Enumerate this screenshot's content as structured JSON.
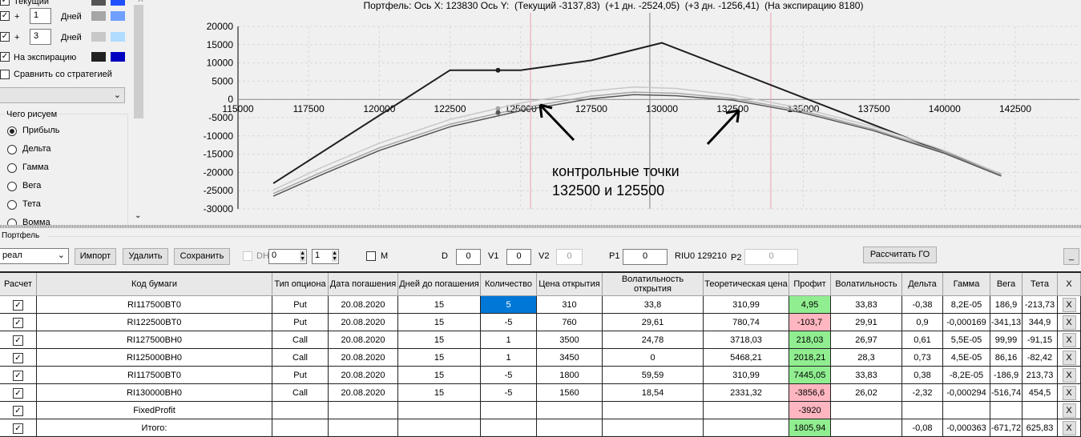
{
  "left_panel": {
    "rows": [
      {
        "label": "Текущий",
        "checked": true,
        "colors": [
          "#555555",
          "#2050ff"
        ]
      },
      {
        "prefix": "+",
        "days": "1",
        "label": "Дней",
        "checked": true,
        "colors": [
          "#a6a6a6",
          "#70a0ff"
        ]
      },
      {
        "prefix": "+",
        "days": "3",
        "label": "Дней",
        "checked": true,
        "colors": [
          "#c8c8c8",
          "#b0dcff"
        ]
      },
      {
        "label": "На экспирацию",
        "checked": true,
        "colors": [
          "#202020",
          "#0000c0"
        ]
      }
    ],
    "compare_label": "Сравнить со стратегией",
    "compare_select": "",
    "group_title": "Чего рисуем",
    "radios": [
      "Прибыль",
      "Дельта",
      "Гамма",
      "Вега",
      "Тета",
      "Вомма"
    ],
    "selected_radio": "Прибыль",
    "close_label": "X"
  },
  "chart_data": {
    "type": "line",
    "title": "Портфель: Ось X: 123830 Ось Y:  (Текущий -3137,83)  (+1 дн. -2524,05)  (+3 дн. -1256,41)  (На экспирацию 8180)",
    "xlim": [
      115000,
      142500
    ],
    "ylim": [
      -30000,
      20000
    ],
    "x_ticks": [
      115000,
      117500,
      120000,
      122500,
      125000,
      127500,
      130000,
      132500,
      135000,
      137500,
      140000,
      142500
    ],
    "y_ticks": [
      20000,
      15000,
      10000,
      5000,
      0,
      -5000,
      -10000,
      -15000,
      -20000,
      -25000,
      -30000
    ],
    "grid": true,
    "vertical_markers": [
      {
        "x": 125350,
        "color": "#f0a0b0"
      },
      {
        "x": 133850,
        "color": "#f0a0b0"
      },
      {
        "x": 129570,
        "color": "#808080"
      }
    ],
    "series": [
      {
        "key": "expiration",
        "color": "#202020",
        "points": [
          [
            116250,
            -23000
          ],
          [
            122500,
            8000
          ],
          [
            125000,
            8000
          ],
          [
            127500,
            10700
          ],
          [
            130000,
            15500
          ],
          [
            142000,
            -20500
          ]
        ],
        "marker": [
          124200,
          8000
        ]
      },
      {
        "key": "plus3",
        "color": "#c8c8c8",
        "points": [
          [
            116250,
            -24800
          ],
          [
            118000,
            -18500
          ],
          [
            120000,
            -12000
          ],
          [
            122500,
            -5500
          ],
          [
            125000,
            -1000
          ],
          [
            127500,
            2300
          ],
          [
            129000,
            3400
          ],
          [
            130500,
            3000
          ],
          [
            132500,
            1200
          ],
          [
            135000,
            -2500
          ],
          [
            137500,
            -7500
          ],
          [
            140000,
            -14000
          ],
          [
            142000,
            -20500
          ]
        ]
      },
      {
        "key": "plus1",
        "color": "#a6a6a6",
        "points": [
          [
            116250,
            -25800
          ],
          [
            118000,
            -19800
          ],
          [
            120000,
            -13300
          ],
          [
            122500,
            -6800
          ],
          [
            125000,
            -2400
          ],
          [
            127500,
            900
          ],
          [
            129000,
            2000
          ],
          [
            130500,
            1700
          ],
          [
            132500,
            300
          ],
          [
            135000,
            -3200
          ],
          [
            137500,
            -8200
          ],
          [
            140000,
            -14500
          ],
          [
            142000,
            -20800
          ]
        ],
        "marker": [
          124200,
          -2500
        ]
      },
      {
        "key": "current",
        "color": "#555555",
        "points": [
          [
            116250,
            -26500
          ],
          [
            118000,
            -20500
          ],
          [
            120000,
            -14000
          ],
          [
            122500,
            -7500
          ],
          [
            125000,
            -3100
          ],
          [
            127500,
            200
          ],
          [
            129000,
            1300
          ],
          [
            130500,
            1000
          ],
          [
            132500,
            -200
          ],
          [
            135000,
            -3700
          ],
          [
            137500,
            -8600
          ],
          [
            140000,
            -14800
          ],
          [
            142000,
            -21000
          ]
        ],
        "marker": [
          124200,
          -3600
        ]
      }
    ],
    "annotation": [
      "контрольные точки",
      "132500 и 125500"
    ]
  },
  "portfolio": {
    "group_title": "Портфель",
    "select_value": "реал",
    "import": "Импорт",
    "delete": "Удалить",
    "save": "Сохранить",
    "dh_label": "DH",
    "spin1": "0",
    "spin2": "1",
    "m_label": "M",
    "d_label": "D",
    "d_value": "0",
    "v1_label": "V1",
    "v1_value": "0",
    "v2_label": "V2",
    "v2_value": "0",
    "p1_label": "P1",
    "p1_value": "0",
    "riu_label": "RIU0 129210",
    "p2_label": "P2",
    "p2_value": "0",
    "calc_go": "Рассчитать ГО",
    "minimize": "_"
  },
  "table": {
    "headers": [
      "Расчет",
      "Код бумаги",
      "Тип опциона",
      "Дата погашения",
      "Дней до погашения",
      "Количество",
      "Цена открытия",
      "Волатильность открытия",
      "Теоретическая цена",
      "Профит",
      "Волатильность",
      "Дельта",
      "Гамма",
      "Вега",
      "Тета",
      "X"
    ],
    "rows": [
      [
        "✓",
        "RI117500BT0",
        "Put",
        "20.08.2020",
        "15",
        "5",
        "310",
        "33,8",
        "310,99",
        "4,95",
        "33,83",
        "-0,38",
        "8,2E-05",
        "186,9",
        "-213,73",
        "X"
      ],
      [
        "✓",
        "RI122500BT0",
        "Put",
        "20.08.2020",
        "15",
        "-5",
        "760",
        "29,61",
        "780,74",
        "-103,7",
        "29,91",
        "0,9",
        "-0,000169",
        "-341,13",
        "344,9",
        "X"
      ],
      [
        "✓",
        "RI127500BH0",
        "Call",
        "20.08.2020",
        "15",
        "1",
        "3500",
        "24,78",
        "3718,03",
        "218,03",
        "26,97",
        "0,61",
        "5,5E-05",
        "99,99",
        "-91,15",
        "X"
      ],
      [
        "✓",
        "RI125000BH0",
        "Call",
        "20.08.2020",
        "15",
        "1",
        "3450",
        "0",
        "5468,21",
        "2018,21",
        "28,3",
        "0,73",
        "4,5E-05",
        "86,16",
        "-82,42",
        "X"
      ],
      [
        "✓",
        "RI117500BT0",
        "Put",
        "20.08.2020",
        "15",
        "-5",
        "1800",
        "59,59",
        "310,99",
        "7445,05",
        "33,83",
        "0,38",
        "-8,2E-05",
        "-186,9",
        "213,73",
        "X"
      ],
      [
        "✓",
        "RI130000BH0",
        "Call",
        "20.08.2020",
        "15",
        "-5",
        "1560",
        "18,54",
        "2331,32",
        "-3856,6",
        "26,02",
        "-2,32",
        "-0,000294",
        "-516,74",
        "454,5",
        "X"
      ],
      [
        "✓",
        "FixedProfit",
        "",
        "",
        "",
        "",
        "",
        "",
        "",
        "-3920",
        "",
        "",
        "",
        "",
        "",
        "X"
      ],
      [
        "✓",
        "Итого:",
        "",
        "",
        "",
        "",
        "",
        "",
        "",
        "1805,94",
        "",
        "-0,08",
        "-0,000363",
        "-671,72",
        "625,83",
        "X"
      ]
    ],
    "profit_colors": {
      "positive": "#90ee90",
      "negative": "#ffb6c1"
    },
    "selected_color": "#0078d7"
  }
}
